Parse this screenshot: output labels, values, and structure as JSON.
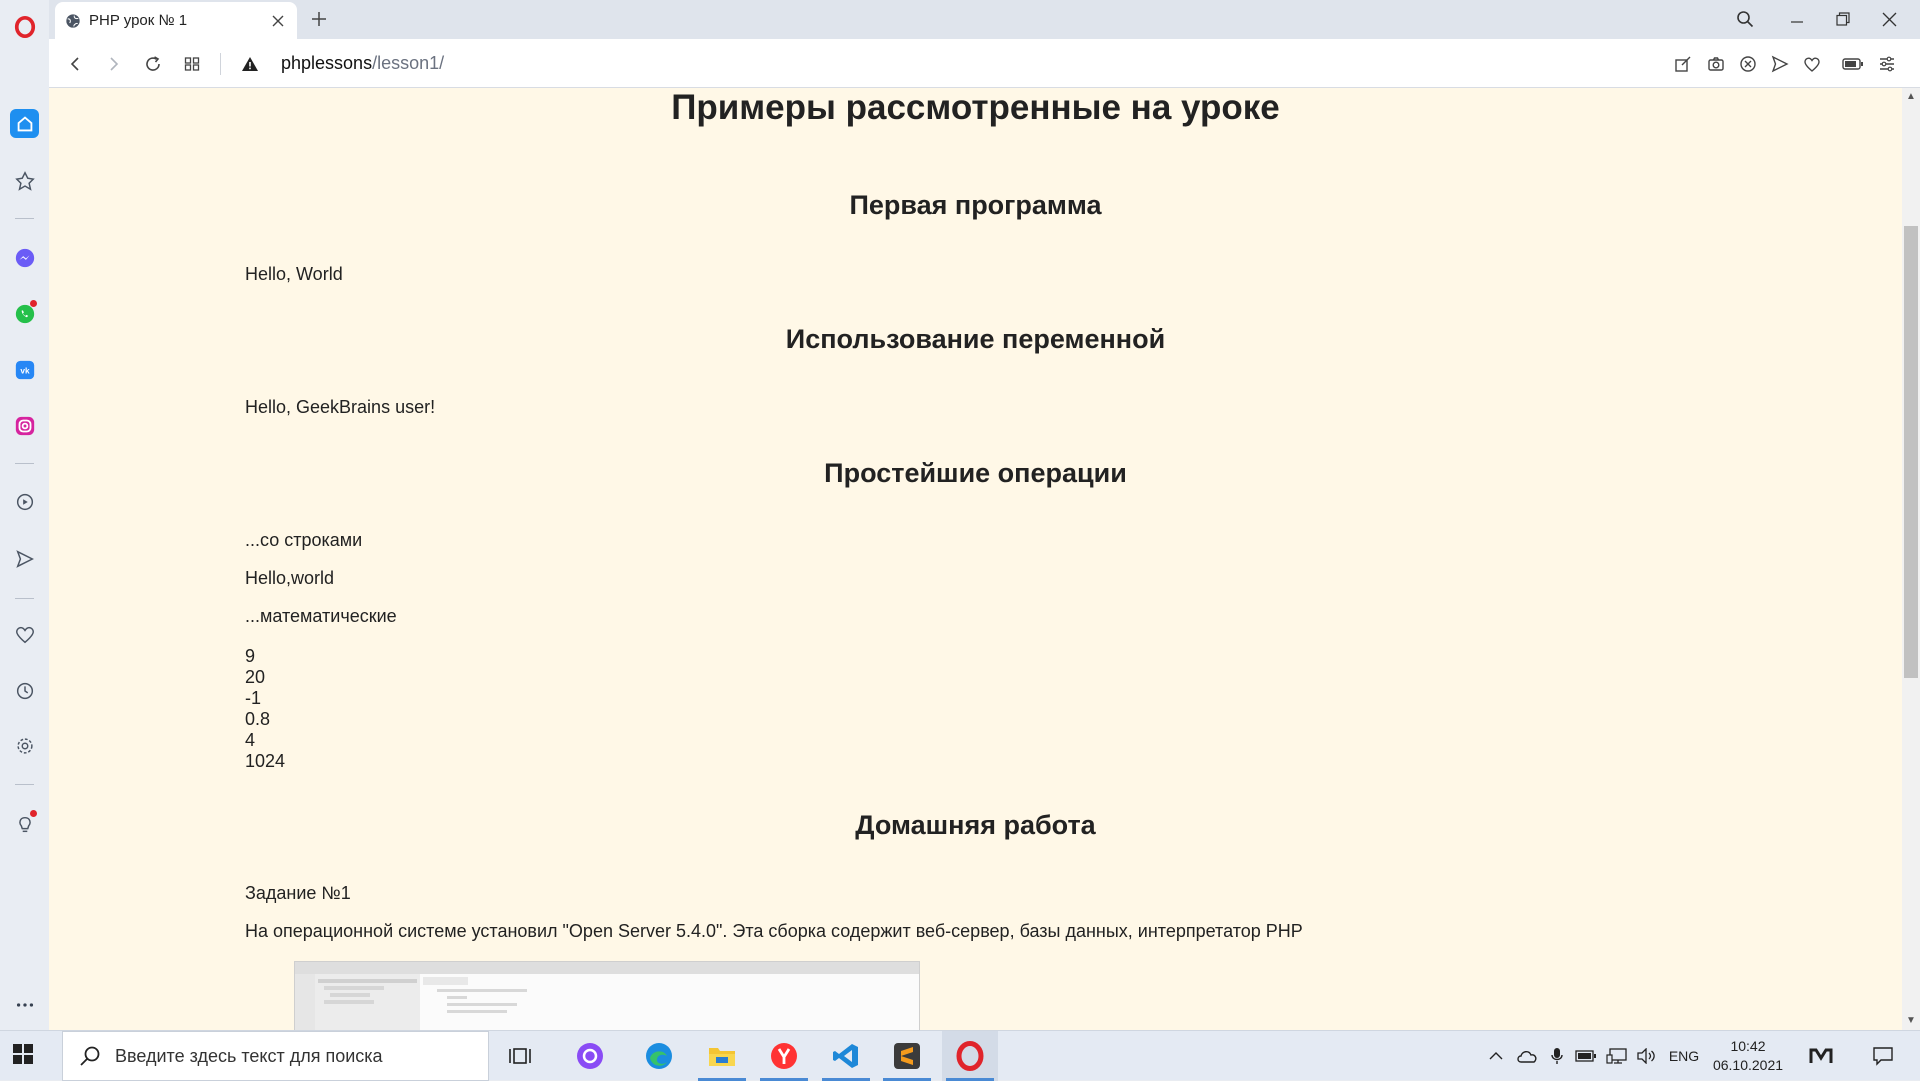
{
  "browser": {
    "tab_title": "PHP урок № 1",
    "url_host": "phplessons",
    "url_path": "/lesson1/"
  },
  "page": {
    "title": "Примеры рассмотренные на уроке",
    "sections": {
      "first_program": {
        "heading": "Первая программа",
        "output": "Hello, World"
      },
      "variable": {
        "heading": "Использование переменной",
        "output": "Hello, GeekBrains user!"
      },
      "operations": {
        "heading": "Простейшие операции",
        "strings_label": "...со строками",
        "strings_output": "Hello,world",
        "math_label": "...математические",
        "math_output": [
          "9",
          "20",
          "-1",
          "0.8",
          "4",
          "1024"
        ]
      },
      "homework": {
        "heading": "Домашняя работа",
        "task_label": "Задание №1",
        "task_text": "На операционной системе установил \"Open Server 5.4.0\". Эта сборка содержит веб-сервер, базы данных, интерпретатор PHP"
      }
    }
  },
  "taskbar": {
    "search_placeholder": "Введите здесь текст для поиска",
    "language": "ENG",
    "time": "10:42",
    "date": "06.10.2021"
  }
}
